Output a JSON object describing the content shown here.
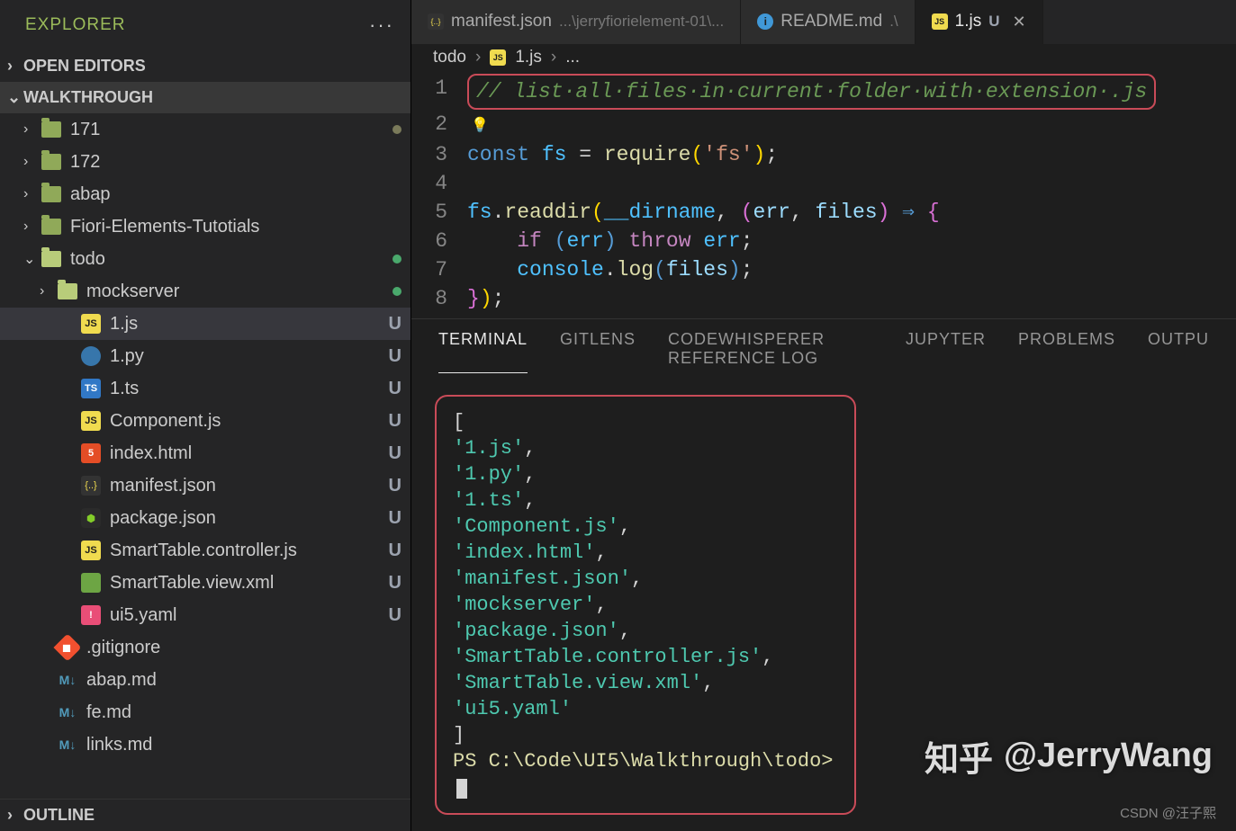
{
  "sidebar": {
    "title": "EXPLORER",
    "sections": {
      "openEditors": "OPEN EDITORS",
      "walkthrough": "WALKTHROUGH",
      "outline": "OUTLINE"
    },
    "tree": [
      {
        "type": "folder",
        "label": "171",
        "indent": 1,
        "collapsed": true,
        "status": "",
        "dot": "grey"
      },
      {
        "type": "folder",
        "label": "172",
        "indent": 1,
        "collapsed": true
      },
      {
        "type": "folder",
        "label": "abap",
        "indent": 1,
        "collapsed": true
      },
      {
        "type": "folder",
        "label": "Fiori-Elements-Tutotials",
        "indent": 1,
        "collapsed": true
      },
      {
        "type": "folder",
        "label": "todo",
        "indent": 1,
        "collapsed": false,
        "dot": "green"
      },
      {
        "type": "folder",
        "label": "mockserver",
        "indent": 2,
        "collapsed": true,
        "open": true,
        "dot": "green"
      },
      {
        "type": "file",
        "icon": "js",
        "label": "1.js",
        "indent": 3,
        "status": "U",
        "selected": true
      },
      {
        "type": "file",
        "icon": "py",
        "label": "1.py",
        "indent": 3,
        "status": "U"
      },
      {
        "type": "file",
        "icon": "ts",
        "label": "1.ts",
        "indent": 3,
        "status": "U"
      },
      {
        "type": "file",
        "icon": "js",
        "label": "Component.js",
        "indent": 3,
        "status": "U"
      },
      {
        "type": "file",
        "icon": "html",
        "label": "index.html",
        "indent": 3,
        "status": "U"
      },
      {
        "type": "file",
        "icon": "json",
        "label": "manifest.json",
        "indent": 3,
        "status": "U"
      },
      {
        "type": "file",
        "icon": "node",
        "label": "package.json",
        "indent": 3,
        "status": "U"
      },
      {
        "type": "file",
        "icon": "js",
        "label": "SmartTable.controller.js",
        "indent": 3,
        "status": "U"
      },
      {
        "type": "file",
        "icon": "xml",
        "label": "SmartTable.view.xml",
        "indent": 3,
        "status": "U"
      },
      {
        "type": "file",
        "icon": "yaml",
        "label": "ui5.yaml",
        "indent": 3,
        "status": "U"
      },
      {
        "type": "file",
        "icon": "git",
        "label": ".gitignore",
        "indent": 2,
        "status": ""
      },
      {
        "type": "file",
        "icon": "md",
        "label": "abap.md",
        "indent": 2,
        "status": ""
      },
      {
        "type": "file",
        "icon": "md",
        "label": "fe.md",
        "indent": 2,
        "status": ""
      },
      {
        "type": "file",
        "icon": "md",
        "label": "links.md",
        "indent": 2,
        "status": ""
      }
    ]
  },
  "tabs": [
    {
      "icon": "json",
      "label": "manifest.json",
      "sub": "...\\jerryfiorielement-01\\..."
    },
    {
      "icon": "info",
      "label": "README.md",
      "sub": ".\\"
    },
    {
      "icon": "js",
      "label": "1.js",
      "status": "U",
      "active": true,
      "close": true
    }
  ],
  "breadcrumb": {
    "folder": "todo",
    "file": "1.js",
    "more": "..."
  },
  "code": {
    "lines": [
      "1",
      "2",
      "3",
      "4",
      "5",
      "6",
      "7",
      "8"
    ],
    "comment": "// list·all·files·in·current·folder·with·extension·.js",
    "l3_const": "const",
    "l3_fs": "fs",
    "l3_eq": " = ",
    "l3_req": "require",
    "l3_str": "'fs'",
    "l5_fs": "fs",
    "l5_readdir": "readdir",
    "l5_dirname": "__dirname",
    "l5_err": "err",
    "l5_files": "files",
    "l6_if": "if",
    "l6_err": "err",
    "l6_throw": "throw",
    "l6_err2": "err",
    "l7_console": "console",
    "l7_log": "log",
    "l7_files": "files"
  },
  "panel": {
    "tabs": [
      "TERMINAL",
      "GITLENS",
      "CODEWHISPERER REFERENCE LOG",
      "JUPYTER",
      "PROBLEMS",
      "OUTPU"
    ],
    "active": 0,
    "output": [
      "'1.js'",
      "'1.py'",
      "'1.ts'",
      "'Component.js'",
      "'index.html'",
      "'manifest.json'",
      "'mockserver'",
      "'package.json'",
      "'SmartTable.controller.js'",
      "'SmartTable.view.xml'",
      "'ui5.yaml'"
    ],
    "prompt": "PS C:\\Code\\UI5\\Walkthrough\\todo>"
  },
  "watermark": {
    "zh": "知乎",
    "handle": "@JerryWang"
  },
  "footer": "CSDN @汪子熙",
  "icon_text": {
    "js": "JS",
    "py": "",
    "ts": "TS",
    "html": "5",
    "json": "{..}",
    "node": "⬢",
    "xml": "</>",
    "yaml": "!",
    "git": "◆",
    "md": "M↓",
    "info": "i"
  }
}
